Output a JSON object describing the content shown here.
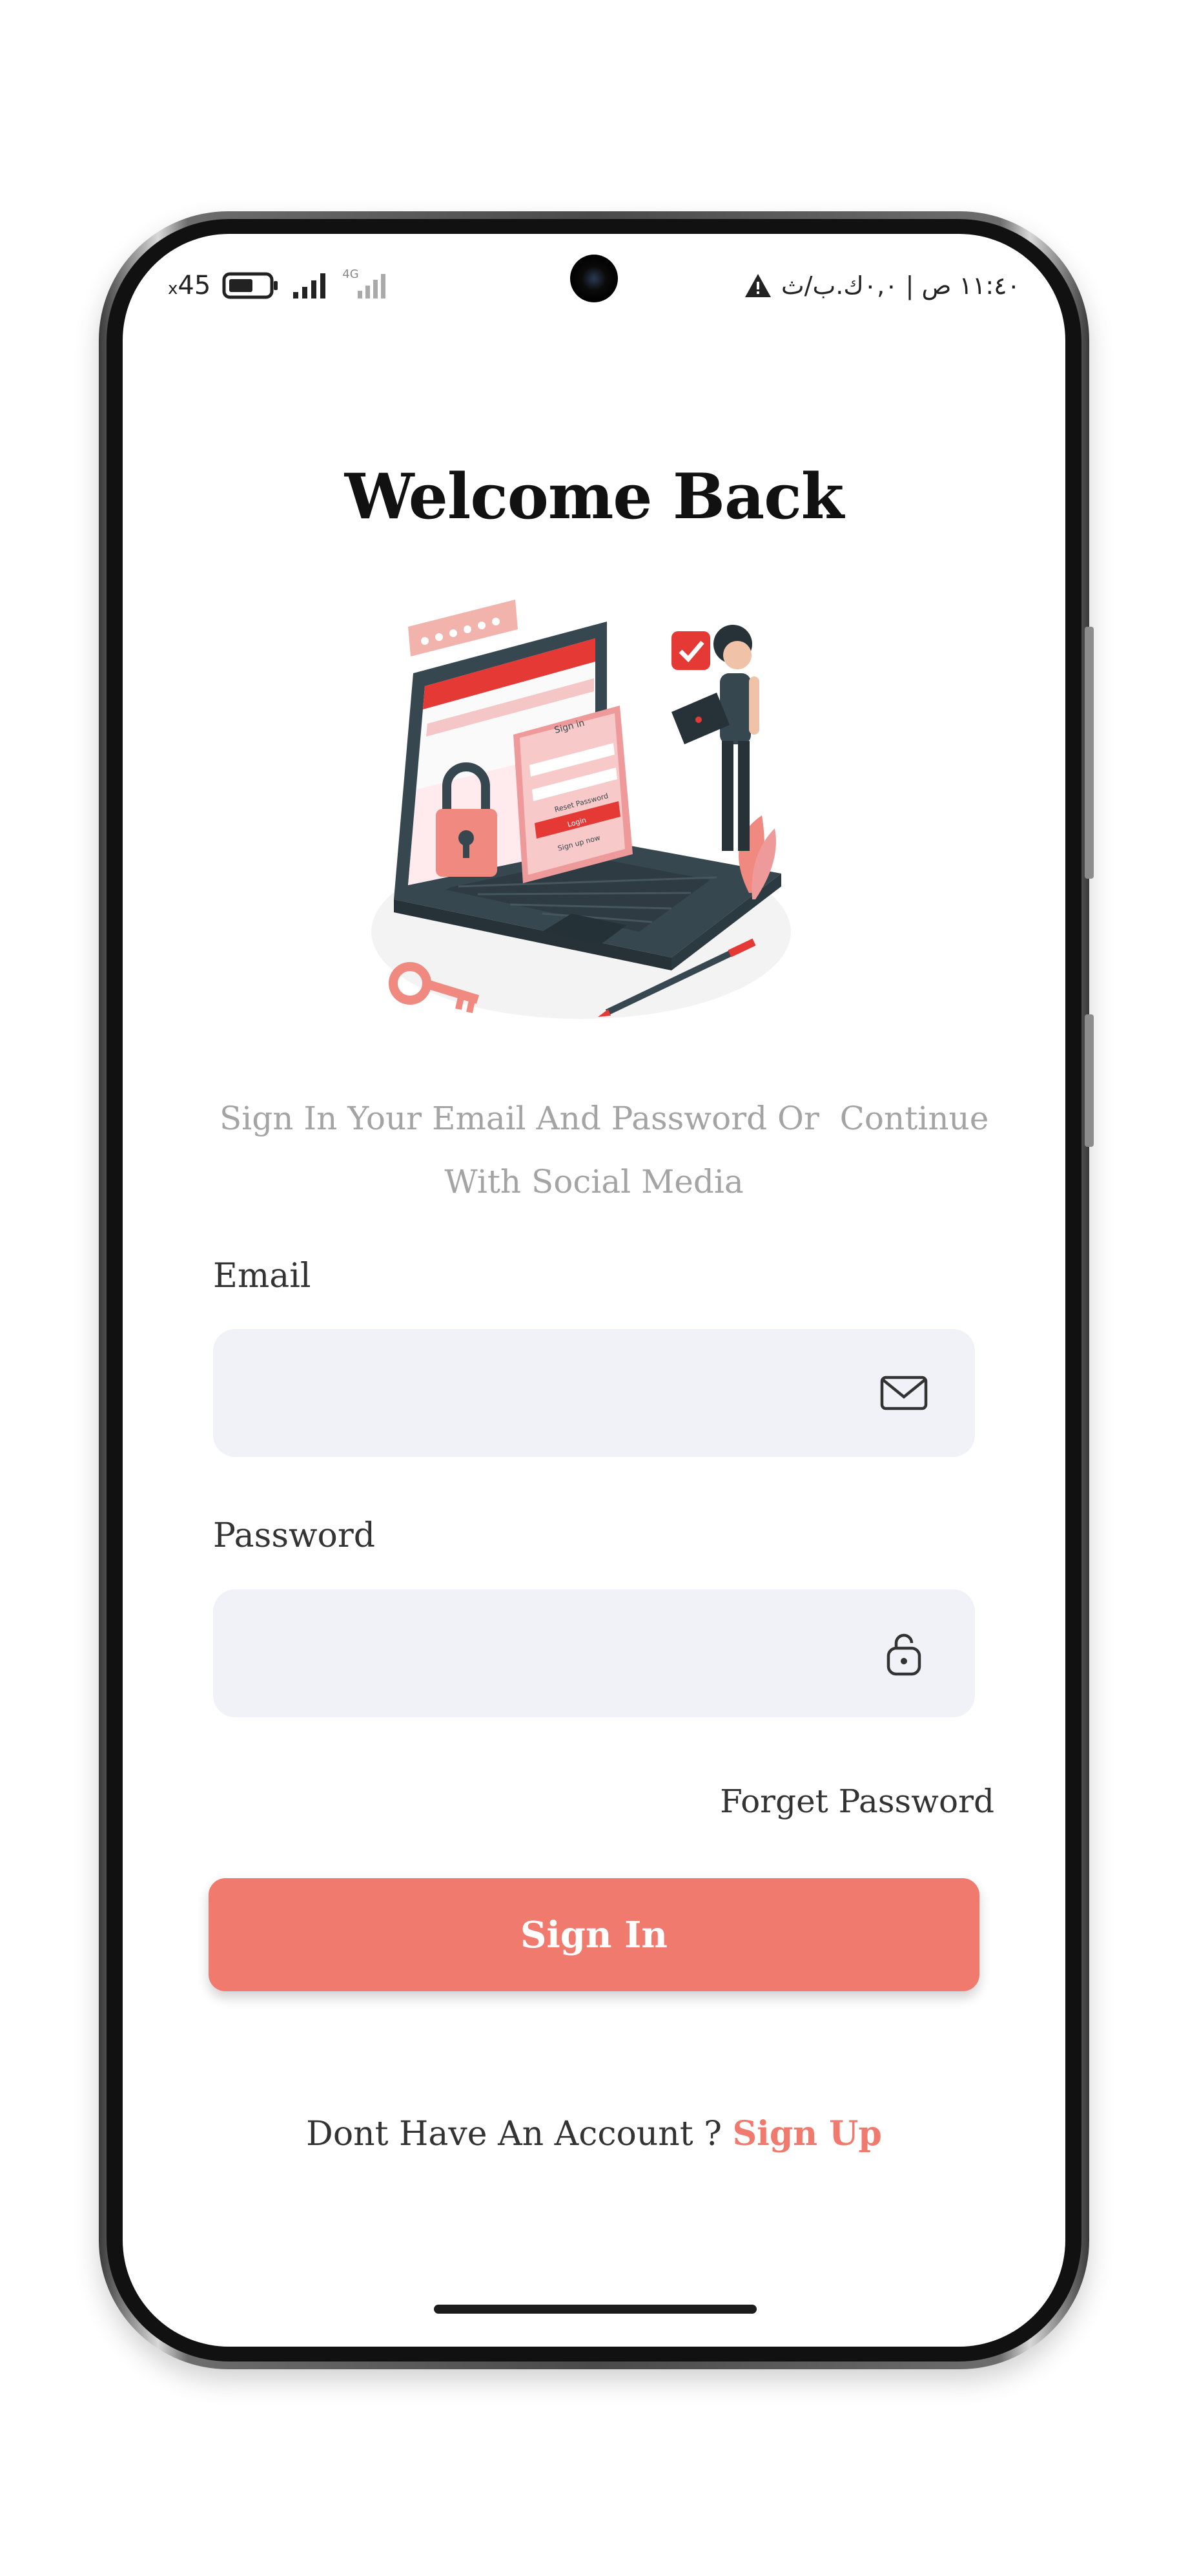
{
  "status_bar": {
    "battery_level": "45",
    "network_small": "4G",
    "right_text": "١١:٤٠ ص | ٠,٠ك.ب/ث",
    "warning_icon": "warning-triangle-icon"
  },
  "screen": {
    "title": "Welcome Back",
    "subtitle_line1": "Sign In Your Email And Password Or  Continue",
    "subtitle_line2": "With Social Media",
    "illustration_texts": {
      "panel_title": "Sign in",
      "reset": "Reset Password",
      "login": "Login",
      "signup": "Sign up now"
    }
  },
  "form": {
    "email_label": "Email",
    "email_value": "",
    "email_icon": "envelope-icon",
    "password_label": "Password",
    "password_value": "",
    "password_icon": "lock-icon",
    "forgot_label": "Forget Password",
    "submit_label": "Sign In"
  },
  "footer": {
    "prompt": "Dont Have An Account ? ",
    "signup_label": "Sign Up"
  },
  "colors": {
    "accent": "#f07a6e",
    "field_bg": "#f1f2f7",
    "title": "#111111",
    "subtitle": "#a4a4a4"
  }
}
